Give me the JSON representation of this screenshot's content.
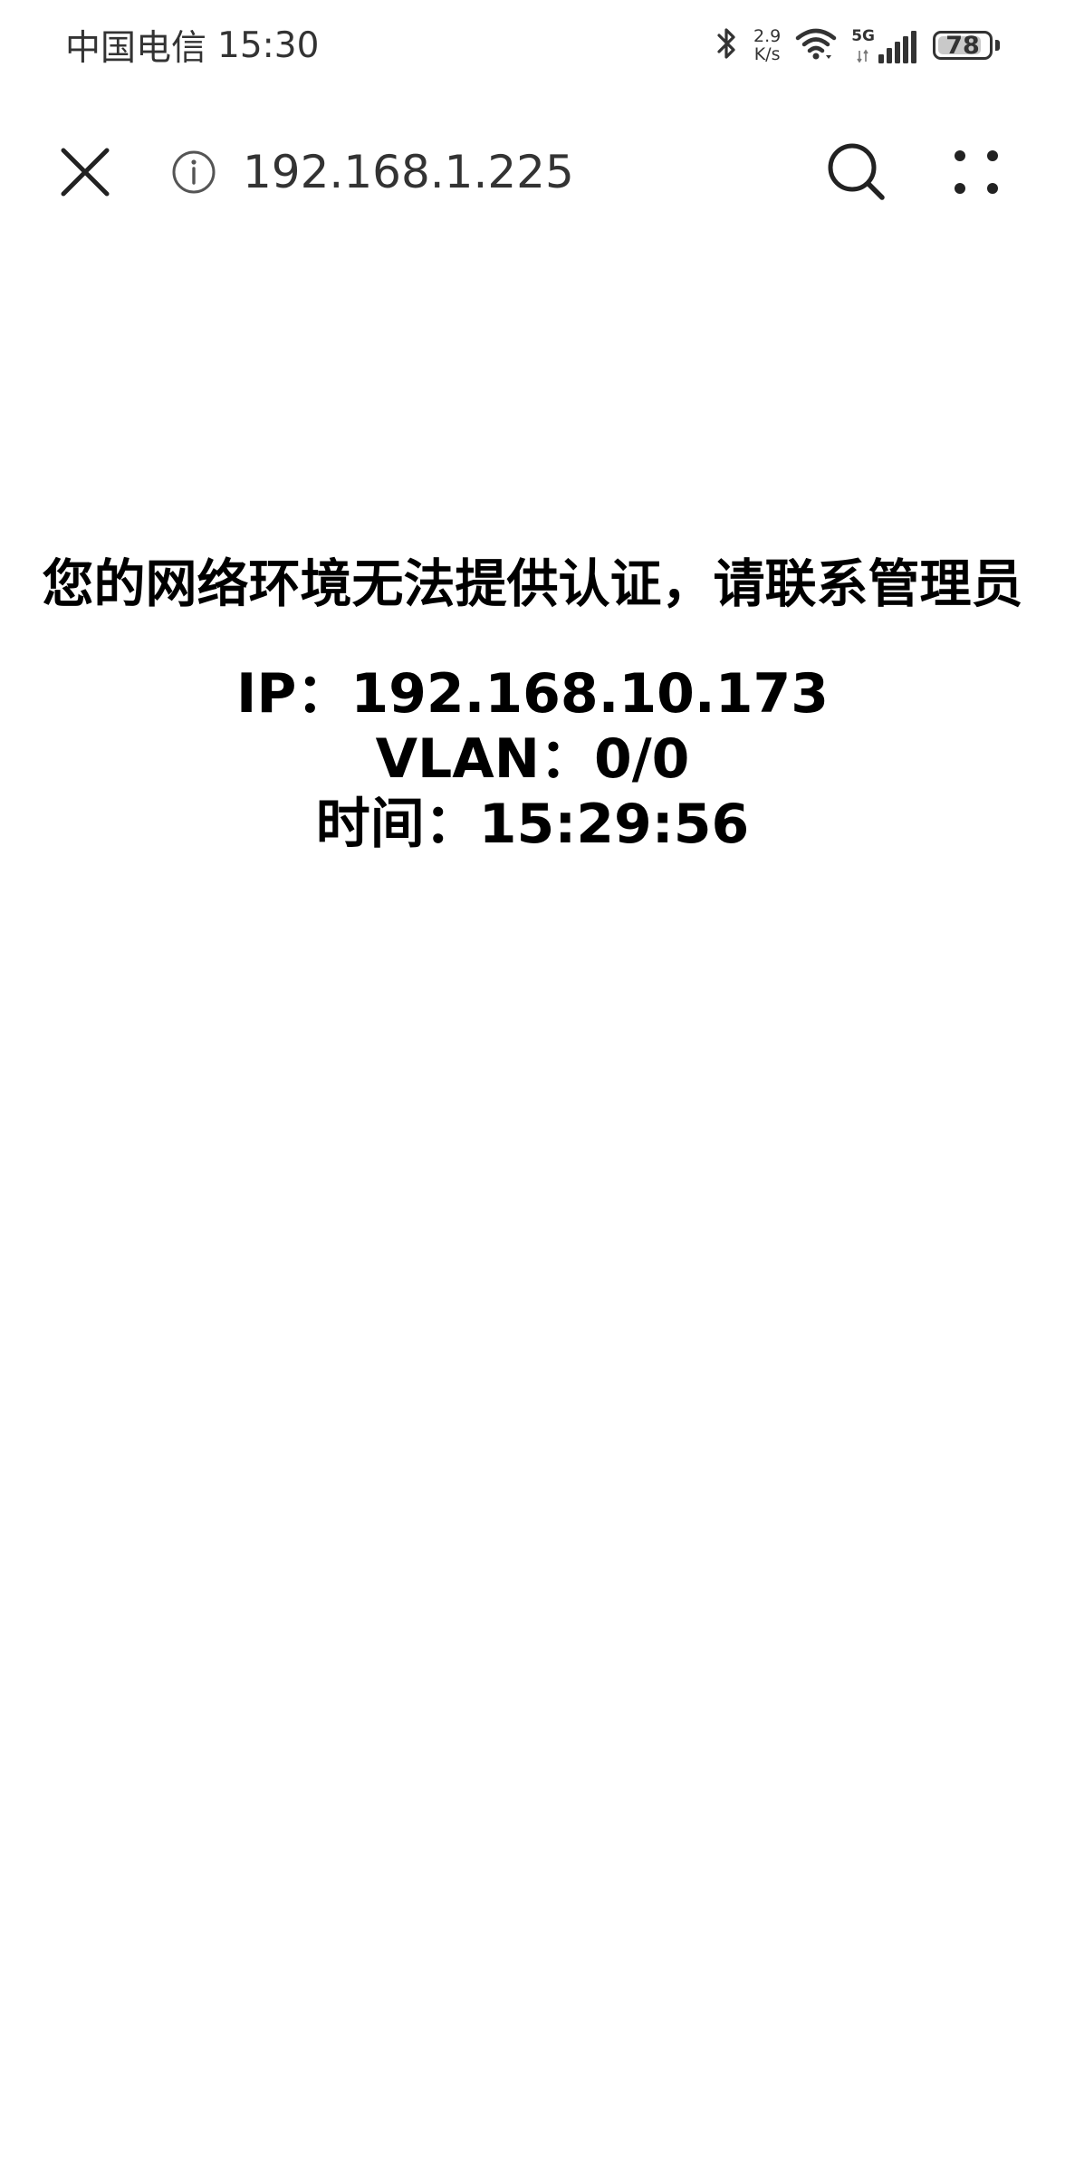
{
  "status_bar": {
    "carrier": "中国电信",
    "time": "15:30",
    "speed_value": "2.9",
    "speed_unit": "K/s",
    "network_type": "5G",
    "battery_level": "78",
    "icons": [
      "bluetooth-icon",
      "wifi-icon",
      "signal-icon",
      "battery-icon"
    ]
  },
  "toolbar": {
    "url": "192.168.1.225",
    "icons": [
      "close-icon",
      "info-icon",
      "search-icon",
      "more-menu-icon"
    ]
  },
  "page": {
    "message": "您的网络环境无法提供认证，请联系管理员",
    "ip_label": "IP：",
    "ip_value": "192.168.10.173",
    "vlan_label": "VLAN：",
    "vlan_value": "0/0",
    "time_label": "时间：",
    "time_value": "15:29:56"
  },
  "colors": {
    "background": "#ffffff",
    "text": "#000000",
    "chrome_text": "#333333"
  }
}
